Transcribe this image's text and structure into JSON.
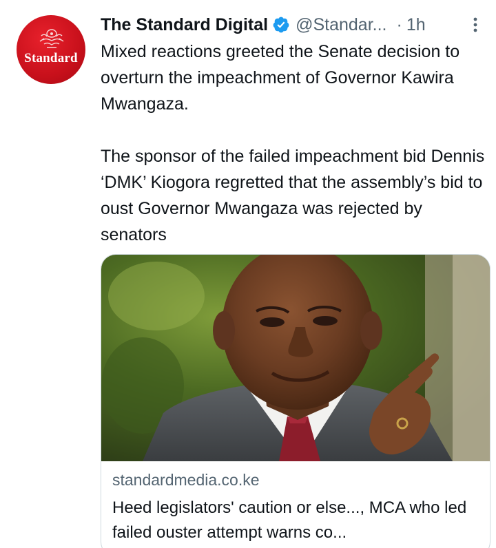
{
  "account": {
    "display_name": "The Standard Digital",
    "handle": "@Standar...",
    "separator": "·",
    "time": "1h",
    "avatar_wordmark": "Standard"
  },
  "tweet": {
    "paragraph_1": "Mixed reactions greeted the Senate decision to overturn the impeachment of Governor Kawira Mwangaza.",
    "paragraph_2": "The sponsor of the failed impeachment bid Dennis ‘DMK’ Kiogora regretted that the assembly’s bid to oust Governor Mwangaza was rejected by senators"
  },
  "card": {
    "domain": "standardmedia.co.ke",
    "title": "Heed legislators' caution or else..., MCA who led failed ouster attempt warns co..."
  },
  "icons": {
    "verified": "verified-badge-icon",
    "more": "more-options-icon"
  },
  "colors": {
    "brand_red": "#c8101b",
    "verified_blue": "#1d9bf0",
    "secondary_text": "#536471"
  }
}
